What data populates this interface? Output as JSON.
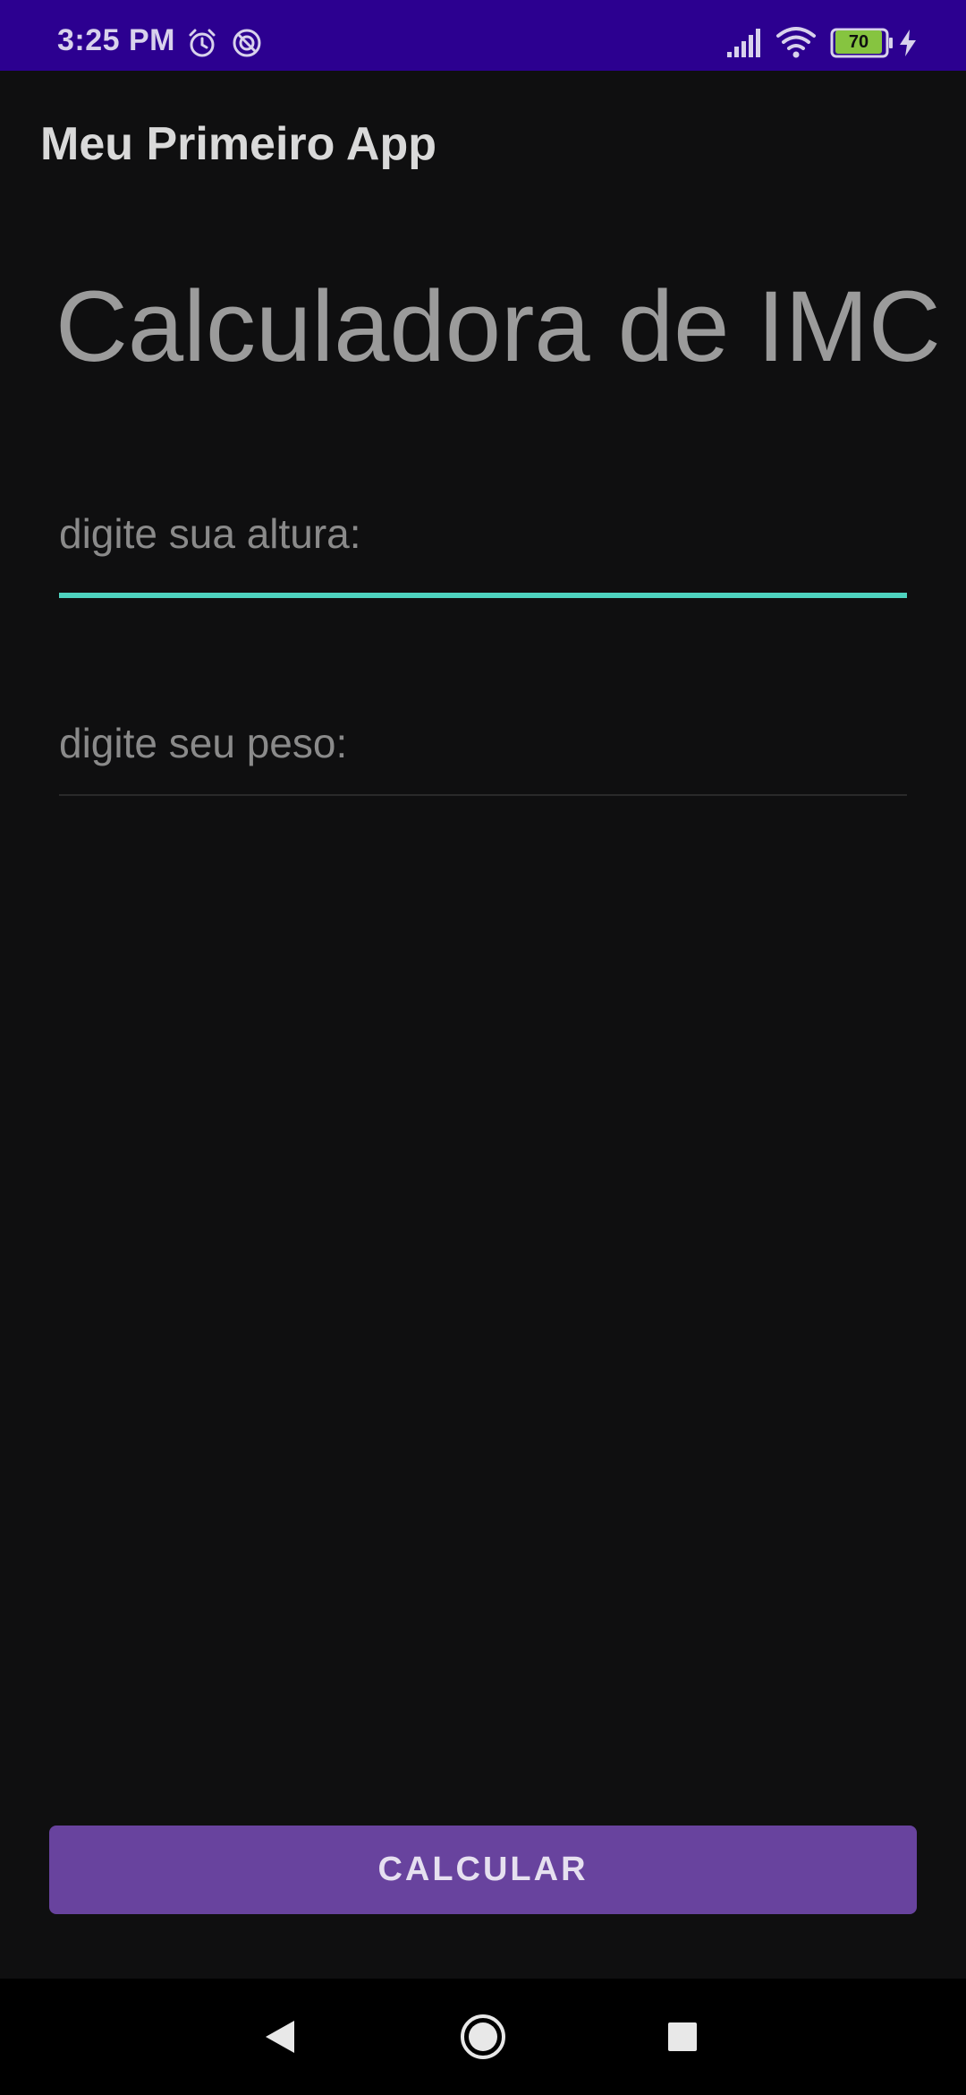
{
  "status_bar": {
    "time": "3:25 PM",
    "battery_level": "70",
    "icons": [
      "alarm-icon",
      "dnd-icon",
      "signal-icon",
      "wifi-icon",
      "battery-icon",
      "charging-bolt-icon"
    ],
    "background": "#2c0090"
  },
  "app_bar": {
    "title": "Meu Primeiro App"
  },
  "main": {
    "title": "Calculadora de IMC",
    "height_field": {
      "value": "",
      "placeholder": "digite sua altura:",
      "focused": true
    },
    "weight_field": {
      "value": "",
      "placeholder": "digite seu peso:"
    },
    "calculate_button": {
      "label": "CALCULAR"
    }
  },
  "nav_bar": {
    "buttons": [
      "back-icon",
      "home-icon",
      "recents-icon"
    ]
  },
  "colors": {
    "accent": "#4ed3bf",
    "button": "#68439e",
    "background": "#0f0f10",
    "status_bar": "#2c0090"
  }
}
